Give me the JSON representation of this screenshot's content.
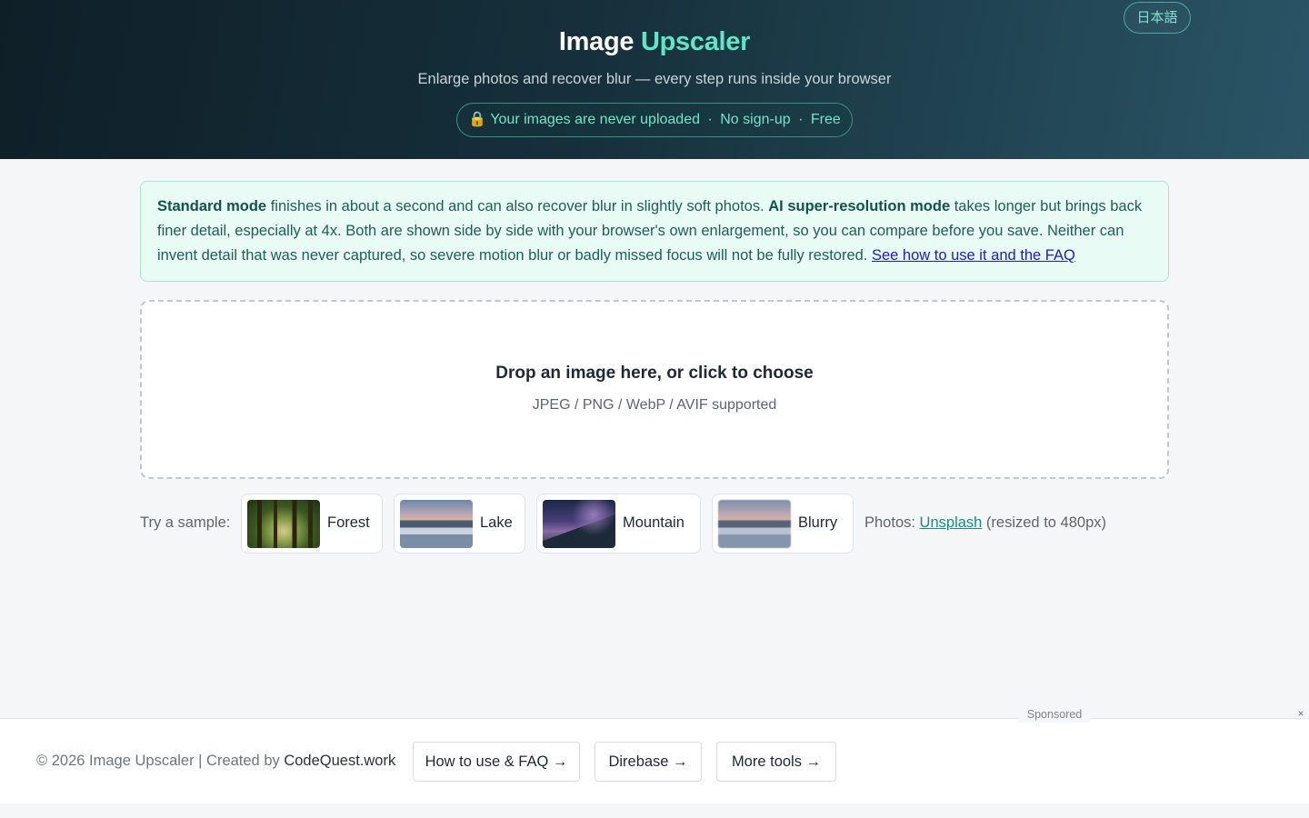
{
  "header": {
    "lang_button": "日本語",
    "title_part1": "Image",
    "title_part2": "Upscaler",
    "subtitle": "Enlarge photos and recover blur — every step runs inside your browser",
    "trust_icon": "lock-icon",
    "trust_lock": "🔒",
    "trust_main": "Your images are never uploaded",
    "trust_sep": "·",
    "trust_nosignup": "No sign-up",
    "trust_free": "Free",
    "accent_color": "#5ee6c6"
  },
  "info": {
    "standard_mode": "Standard mode",
    "standard_text": " finishes in about a second and can also recover blur in slightly soft photos. ",
    "ai_mode": "AI super-resolution mode",
    "ai_text": " takes longer but brings back finer detail, especially at 4x. Both are shown side by side with your browser's own enlargement, so you can compare before you save. Neither can invent detail that was never captured, so severe motion blur or badly missed focus will not be fully restored. ",
    "faq_link": "See how to use it and the FAQ"
  },
  "dropzone": {
    "title": "Drop an image here, or click to choose",
    "formats": "JPEG / PNG / WebP / AVIF supported"
  },
  "samples": {
    "label": "Try a sample:",
    "items": [
      {
        "label": "Forest"
      },
      {
        "label": "Lake"
      },
      {
        "label": "Mountain"
      },
      {
        "label": "Blurry"
      }
    ],
    "credit_prefix": "Photos: ",
    "credit_link": "Unsplash",
    "credit_suffix": " (resized to 480px)"
  },
  "footer": {
    "sponsored": "Sponsored",
    "close": "×",
    "copyright": "© 2026 Image Upscaler | Created by ",
    "creator": "CodeQuest.work",
    "buttons": [
      {
        "label": "How to use & FAQ →"
      },
      {
        "label": "Direbase →"
      },
      {
        "label": "More tools →"
      }
    ]
  }
}
